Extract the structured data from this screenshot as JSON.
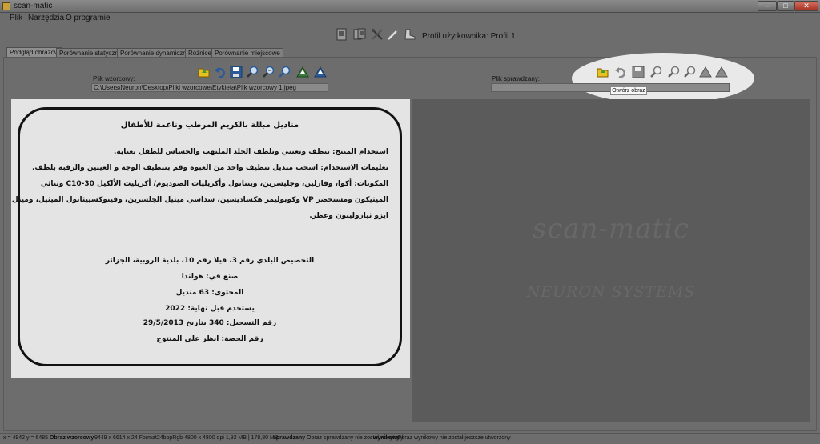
{
  "window": {
    "title": "scan-matic",
    "minimize": "–",
    "maximize": "□",
    "close": "✕"
  },
  "menu": {
    "items": [
      "Plik",
      "Narzędzia",
      "O programie"
    ]
  },
  "toolbar_top": {
    "icons": [
      "scan-page-icon",
      "scan-compare-icon",
      "tools-icon",
      "wand-icon",
      "boot-icon"
    ]
  },
  "profile": {
    "text": "Profil użytkownika: Profil 1"
  },
  "tabs": [
    "Podgląd obrazów",
    "Porównanie statyczne",
    "Porównanie dynamiczne",
    "Różnice",
    "Porównanie miejscowe"
  ],
  "left_panel": {
    "label": "Plik wzorcowy:",
    "path": "C:\\Users\\Neuron\\Desktop\\Pliki wzorcowe\\Etykieta\\Plik wzorcowy 1.jpeg"
  },
  "right_panel": {
    "label": "Plik sprawdzany:",
    "path": "",
    "tooltip": "Otwórz obraz"
  },
  "toolbar_icons": [
    "open-folder-icon",
    "undo-icon",
    "save-icon",
    "zoom-in-icon",
    "zoom-out-icon",
    "zoom-fit-icon",
    "triangle-left-icon",
    "triangle-right-icon"
  ],
  "label_lines": {
    "title": "مناديل مبللة بالكريم المرطب وناعمة للأطفال",
    "l1": "استخدام المنتج: تنظف وتعتني وتلطف الجلد الملتهب والحساس للطفل بعناية.",
    "l2": "تعليمات الاستخدام: اسحب منديل تنظيف واحد من العبوة وقم بتنظيف الوجه و العينين والرقبة بلطف.",
    "l3": "المكونات: أكوا، وفازلين، وجليسرين، وبنتانول وأكريليات الصوديوم/ أكريليت الألكيل C10-30 وثنائي",
    "l4": "الميثيكون ومستحضر VP وكوبوليمر هكساديسين، سداسي ميثيل الجلسرين، وفينوكسييثانول الميثيل، وميثل",
    "l5": "ايزو ثيازولينون وعطر.",
    "a1": "التخصيص البلدي رقم 3، فيلا رقم 10، بلدية الروبية، الجزائر",
    "a2": "صنع في: هولندا",
    "a3": "المحتوى: 63 منديل",
    "a4": "يستخدم قبل نهاية: 2022",
    "a5": "رقم التسجيل: 340 بتاريخ 29/5/2013",
    "a6": "رقم الحصة: انظر على المنتوج"
  },
  "watermark": {
    "line1": "scan-matic",
    "line2": "NEURON SYSTEMS"
  },
  "status": {
    "coords": "x = 4942 y = 6485",
    "obraz_wzorcowy_label": "Obraz wzorcowy",
    "obraz_wzorcowy_info": "9449 x 6614 x 24 Format24bppRgb 4800 x 4800 dpi 1,92 MB | 178,80 MB",
    "sprawdzany_label": "sprawdzany",
    "sprawdzany_info": "Obraz sprawdzany nie został wczytany",
    "wynikowy_label": "wynikowy",
    "wynikowy_info": "Obraz wynikowy nie został jeszcze utworzony"
  },
  "colors": {
    "panel_gray": "#6d6d6d",
    "image_bg": "#e4e4e4",
    "dark_image": "#5b5b5b",
    "icon_blue": "#2a5a9a",
    "icon_yellow": "#e8c020"
  }
}
